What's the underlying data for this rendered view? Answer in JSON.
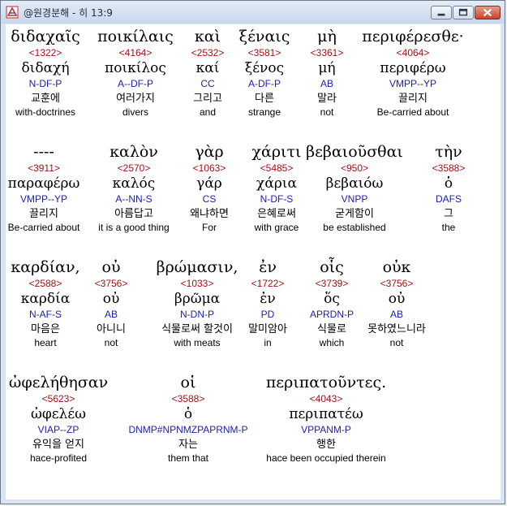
{
  "window": {
    "title": "@원경분해 - 히 13:9",
    "controls": {
      "minimize": "minimize",
      "maximize": "maximize",
      "close": "close"
    }
  },
  "rows": [
    {
      "words": [
        {
          "greek": "διδαχαῖς",
          "strong": "<1322>",
          "lemma": "διδαχή",
          "parse": "N-DF-P",
          "korean": "교훈에",
          "english": "with-doctrines"
        },
        {
          "greek": "ποικίλαις",
          "strong": "<4164>",
          "lemma": "ποικίλος",
          "parse": "A--DF-P",
          "korean": "여러가지",
          "english": "divers"
        },
        {
          "greek": "καὶ",
          "strong": "<2532>",
          "lemma": "καί",
          "parse": "CC",
          "korean": "그리고",
          "english": "and"
        },
        {
          "greek": "ξέναις",
          "strong": "<3581>",
          "lemma": "ξένος",
          "parse": "A-DF-P",
          "korean": "다른",
          "english": "strange"
        },
        {
          "greek": "μὴ",
          "strong": "<3361>",
          "lemma": "μή",
          "parse": "AB",
          "korean": "말라",
          "english": "not"
        },
        {
          "greek": "περιφέρεσθε·",
          "strong": "<4064>",
          "lemma": "περιφέρω",
          "parse": "VMPP--YP",
          "korean": "끌리지",
          "english": "Be-carried about"
        }
      ]
    },
    {
      "words": [
        {
          "greek": "----",
          "strong": "<3911>",
          "lemma": "παραφέρω",
          "parse": "VMPP--YP",
          "korean": "끌리지",
          "english": "Be-carried about"
        },
        {
          "greek": "καλὸν",
          "strong": "<2570>",
          "lemma": "καλός",
          "parse": "A--NN-S",
          "korean": "아름답고",
          "english": "it is a good thing"
        },
        {
          "greek": "γὰρ",
          "strong": "<1063>",
          "lemma": "γάρ",
          "parse": "CS",
          "korean": "왜냐하면",
          "english": "For"
        },
        {
          "greek": "χάριτι",
          "strong": "<5485>",
          "lemma": "χάρια",
          "parse": "N-DF-S",
          "korean": "은혜로써",
          "english": "with grace"
        },
        {
          "greek": "βεβαιοῦσθαι",
          "strong": "<950>",
          "lemma": "βεβαιόω",
          "parse": "VNPP",
          "korean": "굳게함이",
          "english": "be established"
        },
        {
          "greek": "τὴν",
          "strong": "<3588>",
          "lemma": "ὁ",
          "parse": "DAFS",
          "korean": "그",
          "english": "the"
        }
      ]
    },
    {
      "words": [
        {
          "greek": "καρδίαν,",
          "strong": "<2588>",
          "lemma": "καρδία",
          "parse": "N-AF-S",
          "korean": "마음은",
          "english": "heart"
        },
        {
          "greek": "οὐ",
          "strong": "<3756>",
          "lemma": "οὐ",
          "parse": "AB",
          "korean": "아니니",
          "english": "not"
        },
        {
          "greek": "βρώμασιν,",
          "strong": "<1033>",
          "lemma": "βρῶμα",
          "parse": "N-DN-P",
          "korean": "식물로써 할것이",
          "english": "with meats"
        },
        {
          "greek": "ἐν",
          "strong": "<1722>",
          "lemma": "ἐν",
          "parse": "PD",
          "korean": "말미암아",
          "english": "in"
        },
        {
          "greek": "οἷς",
          "strong": "<3739>",
          "lemma": "ὅς",
          "parse": "APRDN-P",
          "korean": "식물로",
          "english": "which"
        },
        {
          "greek": "οὐκ",
          "strong": "<3756>",
          "lemma": "οὐ",
          "parse": "AB",
          "korean": "못하였느니라",
          "english": "not"
        }
      ]
    },
    {
      "words": [
        {
          "greek": "ὠφελήθησαν",
          "strong": "<5623>",
          "lemma": "ὠφελέω",
          "parse": "VIAP--ZP",
          "korean": "유익을 얻지",
          "english": "hace-profited"
        },
        {
          "greek": "οἱ",
          "strong": "<3588>",
          "lemma": "ὁ",
          "parse": "DNMP#NPNMZPAPRNM-P",
          "korean": "자는",
          "english": "them that"
        },
        {
          "greek": "περιπατοῦντες.",
          "strong": "<4043>",
          "lemma": "περιπατέω",
          "parse": "VPPANM-P",
          "korean": "행한",
          "english": "hace been occupied therein"
        }
      ]
    }
  ]
}
